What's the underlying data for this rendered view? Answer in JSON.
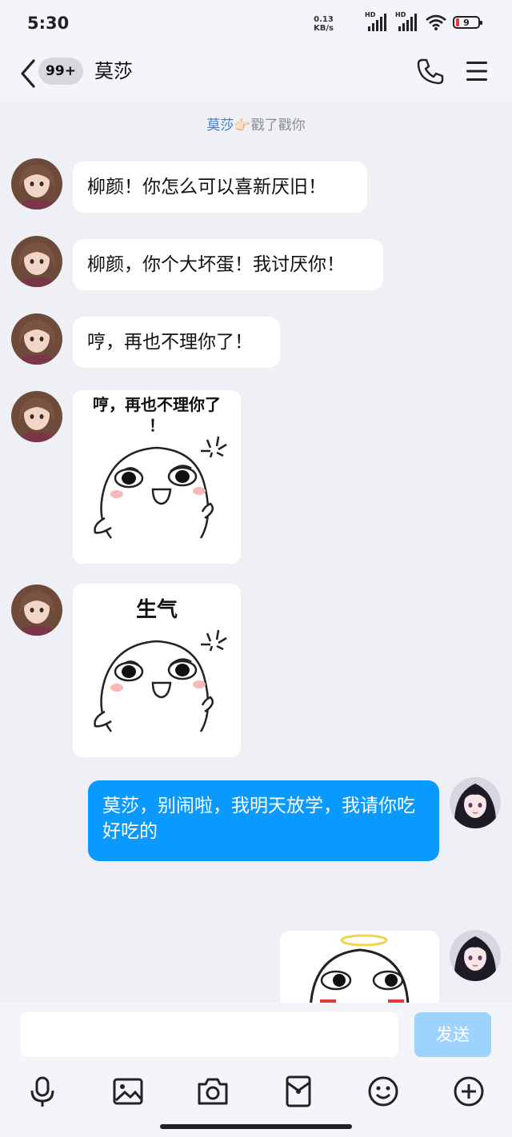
{
  "status": {
    "time": "5:30",
    "net_speed_value": "0.13",
    "net_speed_unit": "KB/s",
    "hd_label": "HD",
    "battery": "9"
  },
  "header": {
    "unread_badge": "99+",
    "title": "莫莎",
    "icons": [
      "back-chevron-icon",
      "phone-icon",
      "menu-icon"
    ]
  },
  "poke": {
    "name": "莫莎",
    "emoji": "👉🏻",
    "text": "戳了戳你"
  },
  "messages": [
    {
      "from": "other",
      "type": "text",
      "text": "柳颜！你怎么可以喜新厌旧！"
    },
    {
      "from": "other",
      "type": "text",
      "text": "柳颜，你个大坏蛋！我讨厌你！"
    },
    {
      "from": "other",
      "type": "text",
      "text": "哼，再也不理你了！"
    },
    {
      "from": "other",
      "type": "sticker",
      "caption_line1": "哼，再也不理你了",
      "caption_line2": "！"
    },
    {
      "from": "other",
      "type": "sticker",
      "caption_line1": "生气"
    },
    {
      "from": "me",
      "type": "text",
      "text": "莫莎，别闹啦，我明天放学，我请你吃好吃的"
    },
    {
      "from": "me",
      "type": "sticker"
    }
  ],
  "input": {
    "placeholder": "",
    "send_label": "发送"
  },
  "toolbar": [
    "microphone-icon",
    "image-icon",
    "camera-icon",
    "red-packet-icon",
    "emoji-icon",
    "plus-icon"
  ],
  "colors": {
    "my_bubble": "#0a99ff",
    "send_disabled": "#9fd3ff",
    "poke_name": "#3a7bd5"
  }
}
